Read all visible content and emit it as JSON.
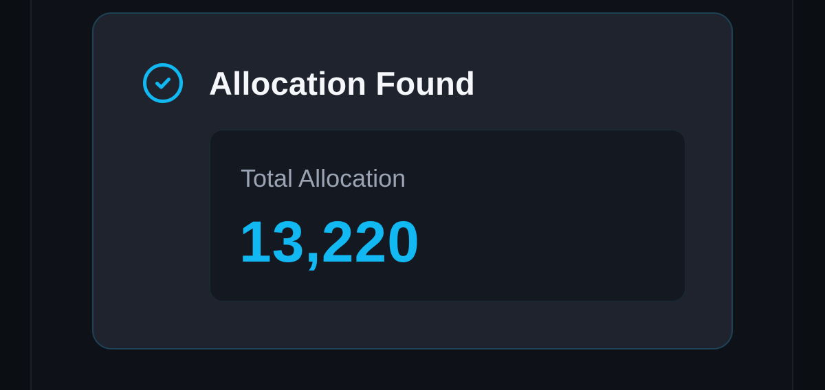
{
  "result_card": {
    "title": "Allocation Found",
    "status_icon": "check-circle-icon",
    "allocation": {
      "label": "Total Allocation",
      "value": "13,220"
    }
  },
  "colors": {
    "page_background": "#0b0e13",
    "card_background": "#1f232d",
    "card_border": "#1d4256",
    "accent": "#12b8f2",
    "title_text": "#f5f7fa",
    "muted_text": "#9ba4b3",
    "inner_background": "#141820"
  }
}
